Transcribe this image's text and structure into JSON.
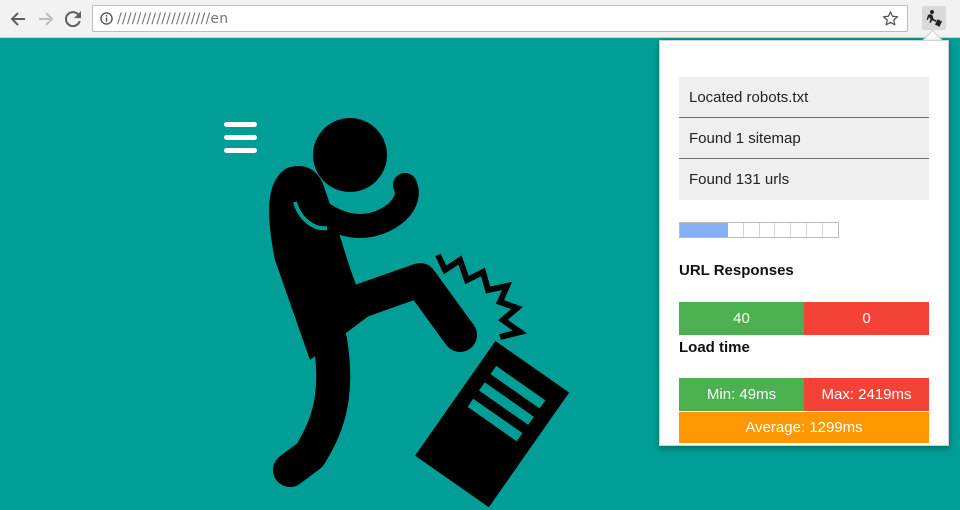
{
  "browser": {
    "url": "///////////////////en",
    "icons": [
      "back-arrow-icon",
      "forward-arrow-icon",
      "reload-icon",
      "info-icon",
      "star-icon",
      "extension-icon"
    ]
  },
  "page": {
    "icons": [
      "hamburger-menu-icon",
      "kicking-computer-illustration"
    ],
    "background": "#009e96"
  },
  "popup": {
    "status_items": [
      "Located robots.txt",
      "Found 1 sitemap",
      "Found 131 urls"
    ],
    "progress": {
      "filled_segments": 3,
      "total_segments": 10
    },
    "url_responses_title": "URL Responses",
    "responses": {
      "ok": "40",
      "error": "0"
    },
    "load_time_title": "Load time",
    "load_time": {
      "min": "Min: 49ms",
      "max": "Max: 2419ms",
      "average": "Average: 1299ms"
    },
    "colors": {
      "green": "#4caf50",
      "red": "#f44336",
      "orange": "#ff9800",
      "progress": "#85aef5"
    }
  }
}
